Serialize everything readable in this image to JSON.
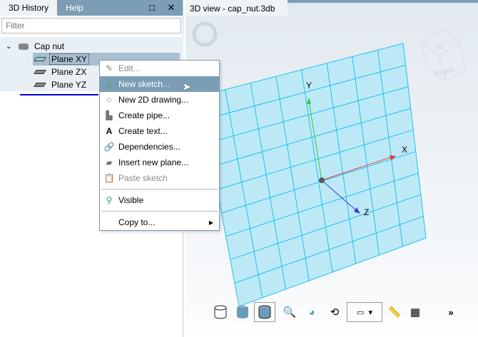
{
  "left_panel": {
    "tabs": [
      {
        "label": "3D History"
      },
      {
        "label": "Help"
      }
    ],
    "maximize_icon": "□",
    "close_icon": "✕",
    "filter_placeholder": "Filter",
    "tree": {
      "root": "Cap nut",
      "children": [
        {
          "label": "Plane XY",
          "selected": true
        },
        {
          "label": "Plane ZX"
        },
        {
          "label": "Plane YZ"
        }
      ]
    }
  },
  "view": {
    "title": "3D view - cap_nut.3db",
    "axes": {
      "x": "X",
      "y": "Y",
      "z": "Z"
    },
    "view_cube": {
      "top": "Top",
      "front": "Front"
    },
    "colors": {
      "plane": "#bde9f7",
      "grid": "#1cc1ef",
      "x": "#e03a3a",
      "y": "#2ecc2e",
      "z": "#3a3ae0"
    },
    "toolbar": {
      "more": "»"
    }
  },
  "context_menu": {
    "items": [
      {
        "label": "Edit...",
        "icon": "edit-icon",
        "disabled": true
      },
      {
        "label": "New sketch...",
        "icon": "new-sketch-icon",
        "highlighted": true
      },
      {
        "label": "New 2D drawing...",
        "icon": "drawing-icon"
      },
      {
        "label": "Create pipe...",
        "icon": "pipe-icon"
      },
      {
        "label": "Create text...",
        "icon": "text-icon"
      },
      {
        "label": "Dependencies...",
        "icon": "link-icon"
      },
      {
        "label": "Insert new plane...",
        "icon": "plane-icon"
      },
      {
        "label": "Paste sketch",
        "icon": "paste-icon",
        "disabled": true
      },
      {
        "label": "Visible",
        "icon": "visible-icon"
      },
      {
        "label": "Copy to...",
        "icon": "",
        "submenu": true
      }
    ]
  }
}
